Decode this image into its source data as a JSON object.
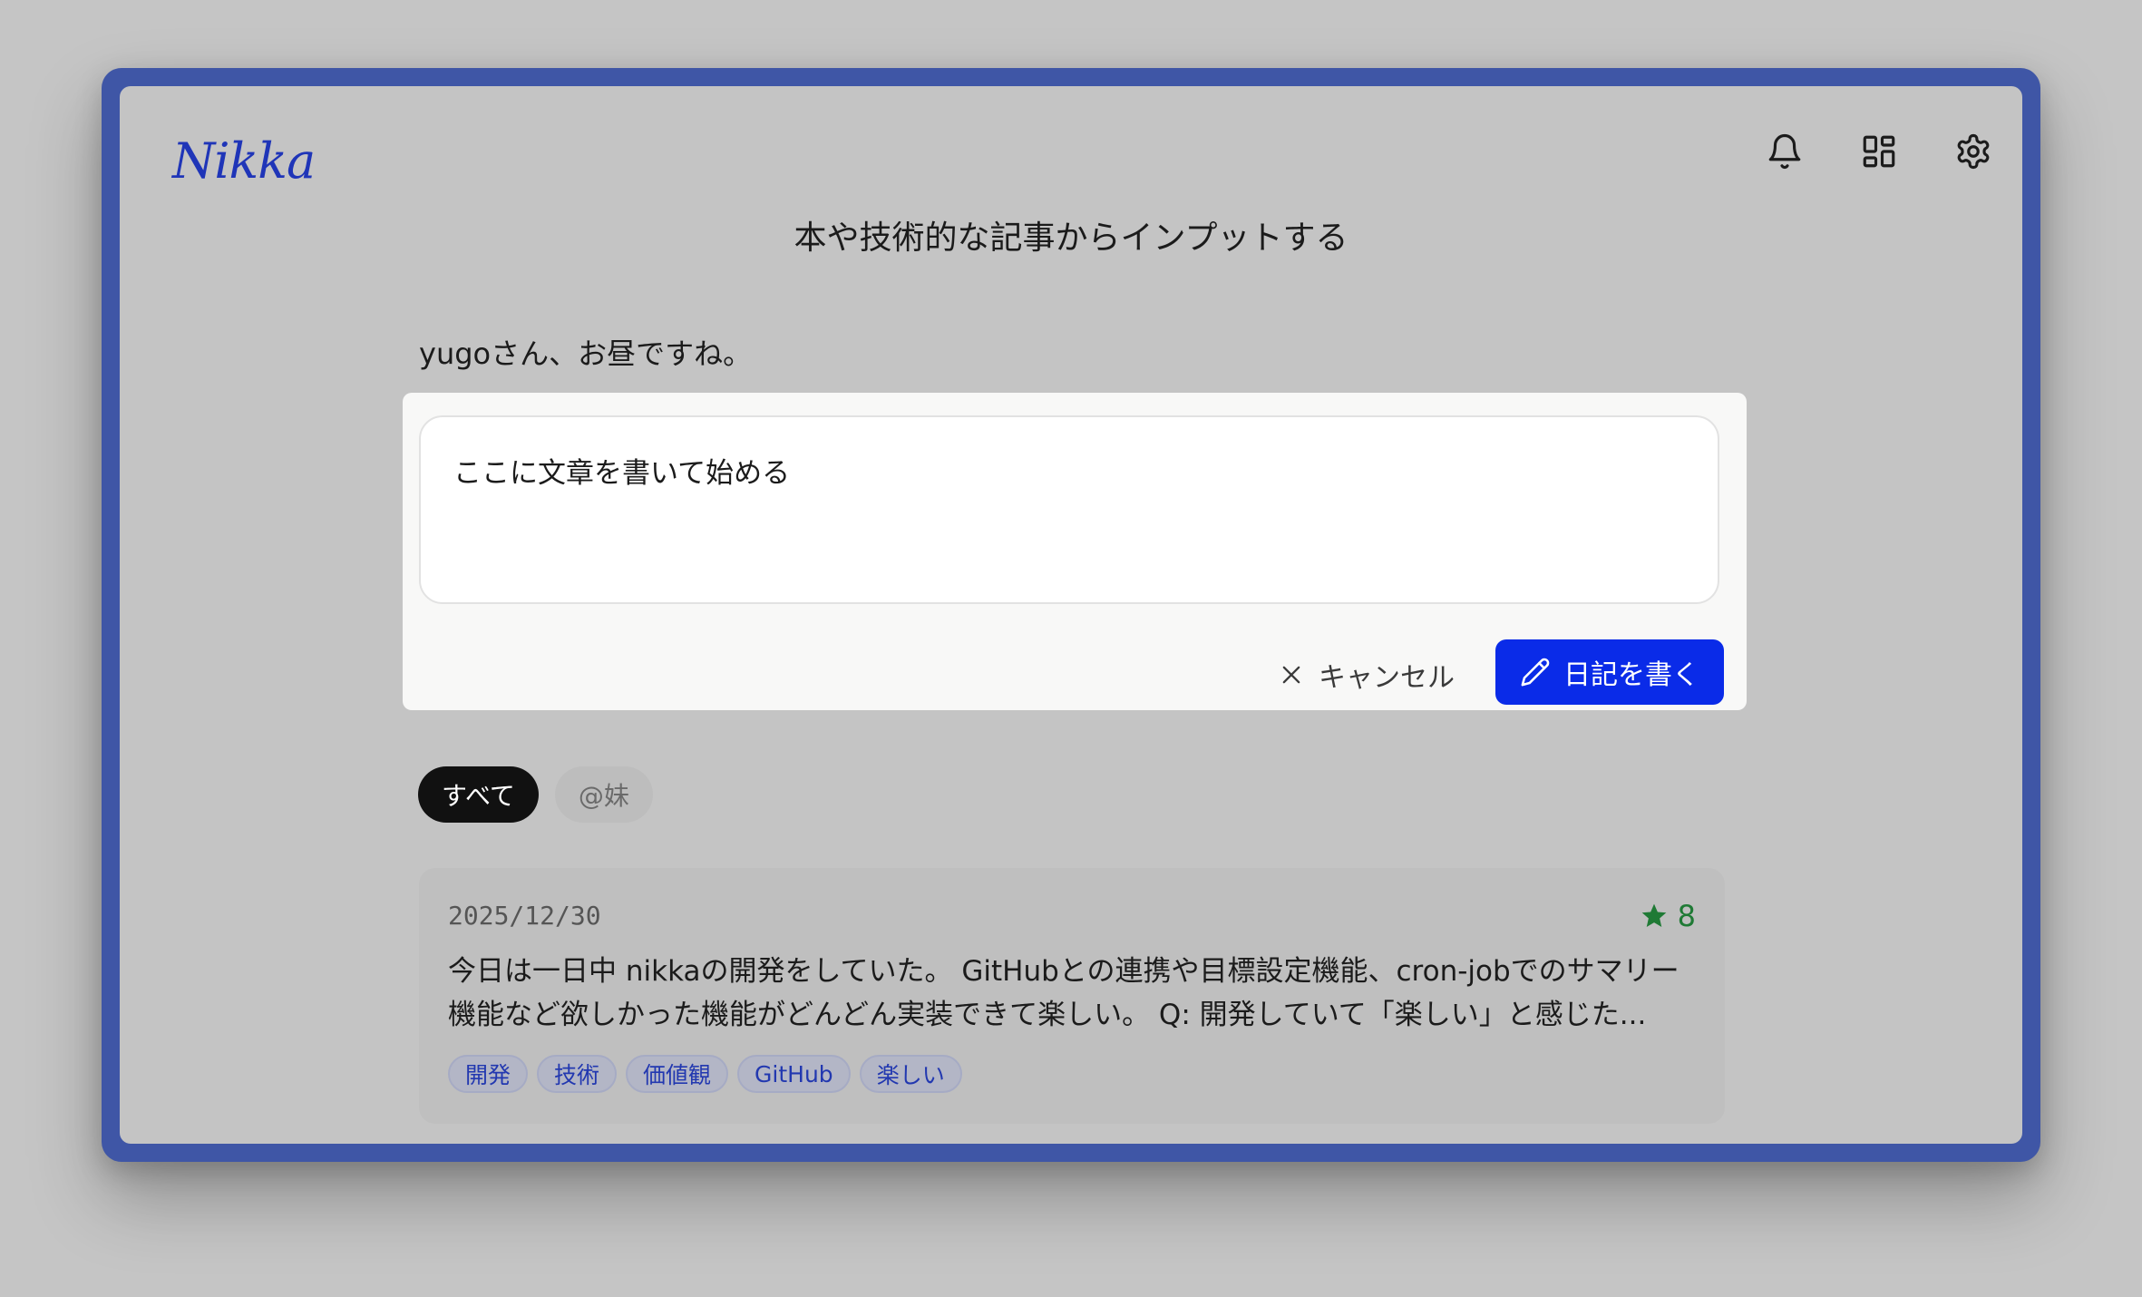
{
  "app": {
    "logo_text": "Nikka"
  },
  "header": {
    "title": "本や技術的な記事からインプットする"
  },
  "greeting": "yugoさん、お昼ですね。",
  "composer": {
    "placeholder": "ここに文章を書いて始める",
    "cancel_label": "キャンセル",
    "submit_label": "日記を書く"
  },
  "filters": {
    "items": [
      {
        "label": "すべて",
        "active": true
      },
      {
        "label": "@妹",
        "active": false
      }
    ]
  },
  "entries": [
    {
      "date": "2025/12/30",
      "star_count": "8",
      "body": "今日は一日中 nikkaの開発をしていた。 GitHubとの連携や目標設定機能、cron-jobでのサマリー機能など欲しかった機能がどんどん実装できて楽しい。 Q: 開発していて「楽しい」と感じた...",
      "tags": [
        "開発",
        "技術",
        "価値観",
        "GitHub",
        "楽しい"
      ]
    }
  ],
  "colors": {
    "frame": "#3f56a6",
    "accent": "#0a2be8",
    "star": "#1f7a35",
    "tag_text": "#2238b0"
  },
  "icons": {
    "notifications": "bell-icon",
    "dashboard": "grid-icon",
    "settings": "gear-icon",
    "cancel": "close-icon",
    "write": "pencil-icon",
    "rating": "star-icon"
  }
}
